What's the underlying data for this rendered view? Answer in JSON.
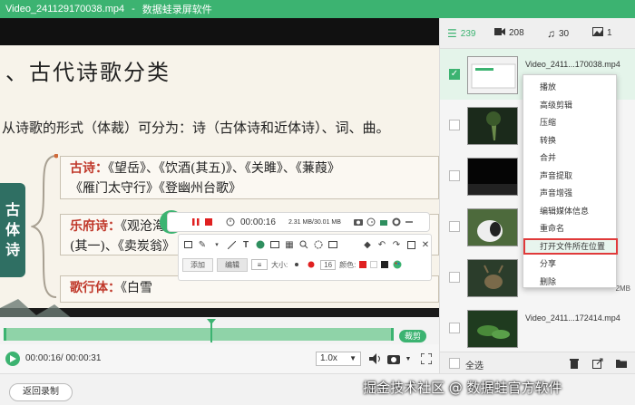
{
  "window": {
    "filename": "Video_241129170038.mp4",
    "separator": "-",
    "app_name": "数据蛙录屏软件"
  },
  "slide": {
    "heading": "、古代诗歌分类",
    "intro": "从诗歌的形式（体裁）可分为：诗（古体诗和近体诗）、词、曲。",
    "badge": [
      "古",
      "体",
      "诗"
    ],
    "boxes": [
      {
        "category": "古诗：",
        "line1": "《望岳》、《饮酒(其五)》、《关雎》、《蒹葭》",
        "line2": "《雁门太守行》《登幽州台歌》"
      },
      {
        "category": "乐府诗：",
        "line1": "《观沧海》《木兰诗》《十五从军征》《行路难》",
        "line2": "(其一)、《卖炭翁》"
      },
      {
        "category": "歌行体：",
        "line1": "《白雪",
        "line2": ""
      }
    ]
  },
  "recorder": {
    "collapse_glyph": "«",
    "timer": "00:00:16",
    "rate": "2.31 MB/30.01 MB",
    "tab_add": "添加",
    "tab_edit": "编辑",
    "size_label": "大小:",
    "size_value": "16",
    "color_label": "颜色:",
    "colors": [
      "#e02020",
      "#ffffff",
      "#222222",
      "#3cb371"
    ]
  },
  "timeline": {
    "trim_label": "裁剪",
    "progress": 0.53
  },
  "controls": {
    "time": "00:00:16/ 00:00:31",
    "speed": "1.0x"
  },
  "bottom": {
    "back_label": "返回录制",
    "watermark": "掘金技术社区 @ 数据蛙官方软件"
  },
  "panel": {
    "tabs": [
      {
        "name": "video",
        "count": "239"
      },
      {
        "name": "record",
        "count": "208"
      },
      {
        "name": "audio",
        "count": "30"
      },
      {
        "name": "image",
        "count": "1"
      }
    ],
    "files": [
      {
        "name": "Video_2411...170038.mp4",
        "size": "",
        "checked": true
      },
      {
        "name": "",
        "size": "",
        "checked": false
      },
      {
        "name": "",
        "size": "",
        "checked": false
      },
      {
        "name": "",
        "size": "",
        "checked": false
      },
      {
        "name": "",
        "size": "2MB",
        "checked": false
      },
      {
        "name": "Video_2411...172414.mp4",
        "size": "",
        "checked": false
      }
    ],
    "select_all": "全选"
  },
  "context_menu": {
    "items": [
      "播放",
      "高级剪辑",
      "压缩",
      "转换",
      "合并",
      "声音提取",
      "声音增强",
      "编辑媒体信息",
      "重命名",
      "打开文件所在位置",
      "分享",
      "删除"
    ],
    "highlighted_index": 9
  },
  "colors": {
    "accent": "#3cb371",
    "highlight_border": "#e03a3a"
  }
}
